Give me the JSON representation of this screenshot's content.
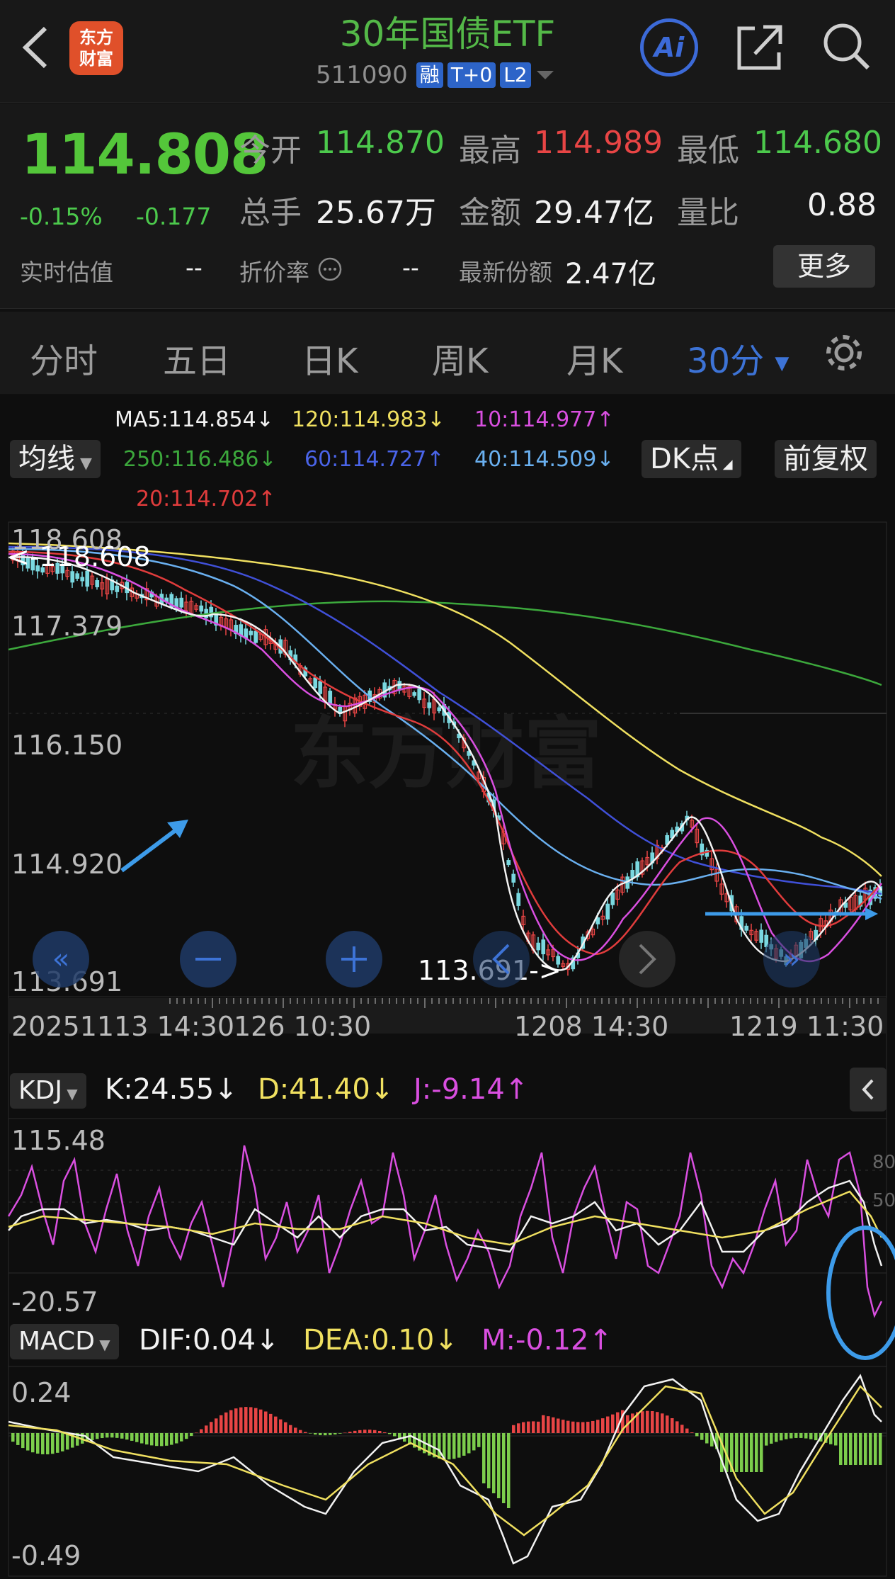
{
  "header": {
    "logo_line1": "东方",
    "logo_line2": "财富",
    "title": "30年国债ETF",
    "code": "511090",
    "tags": [
      "融",
      "T+0",
      "L2"
    ],
    "ai_label": "Ai",
    "icons": [
      "back-arrow-icon",
      "share-icon",
      "search-icon"
    ]
  },
  "quote": {
    "price": "114.808",
    "change_pct": "-0.15%",
    "change": "-0.177",
    "open_label": "今开",
    "open_value": "114.870",
    "high_label": "最高",
    "high_value": "114.989",
    "low_label": "最低",
    "low_value": "114.680",
    "volume_label": "总手",
    "volume_value": "25.67万",
    "amount_label": "金额",
    "amount_value": "29.47亿",
    "ratio_label": "量比",
    "ratio_value": "0.88",
    "estimate_label": "实时估值",
    "estimate_value": "--",
    "discount_label": "折价率",
    "discount_value": "--",
    "shares_label": "最新份额",
    "shares_value": "2.47亿",
    "more_label": "更多"
  },
  "tabs": [
    "分时",
    "五日",
    "日K",
    "周K",
    "月K",
    "30分"
  ],
  "active_tab": "30分",
  "ma": {
    "ma5": "MA5:114.854↓",
    "ma120": "120:114.983↓",
    "ma10": "10:114.977↑",
    "ma250": "250:116.486↓",
    "ma60": "60:114.727↑",
    "ma40": "40:114.509↓",
    "ma20": "20:114.702↑",
    "colors": {
      "ma5": "#f2f2f2",
      "ma10": "#d94fe0",
      "ma20": "#e03c3c",
      "ma40": "#6ab0f0",
      "ma60": "#4050d8",
      "ma120": "#f0e060",
      "ma250": "#3ca83c"
    }
  },
  "controls": {
    "ma_select": "均线",
    "dk_button": "DK点",
    "adjust_button": "前复权"
  },
  "main_chart": {
    "y_labels": [
      "118.608",
      "117.379",
      "116.150",
      "114.920",
      "113.691"
    ],
    "high_marker": "<-118.608",
    "low_marker": "113.691->",
    "x_labels": [
      "20251113 14:30",
      "126 10:30",
      "1208 14:30",
      "1219 11:30"
    ]
  },
  "kdj": {
    "select_label": "KDJ",
    "k": "K:24.55↓",
    "d": "D:41.40↓",
    "j": "J:-9.14↑",
    "y_top": "115.48",
    "y_bottom": "-20.57",
    "right_labels": [
      "80",
      "50"
    ]
  },
  "macd": {
    "select_label": "MACD",
    "dif": "DIF:0.04↓",
    "dea": "DEA:0.10↓",
    "m": "M:-0.12↑",
    "y_top": "0.24",
    "y_bottom": "-0.49"
  },
  "colors": {
    "up": "#e84545",
    "down": "#4cc94c",
    "accent": "#3d73d6",
    "annotation": "#3d9be9"
  }
}
